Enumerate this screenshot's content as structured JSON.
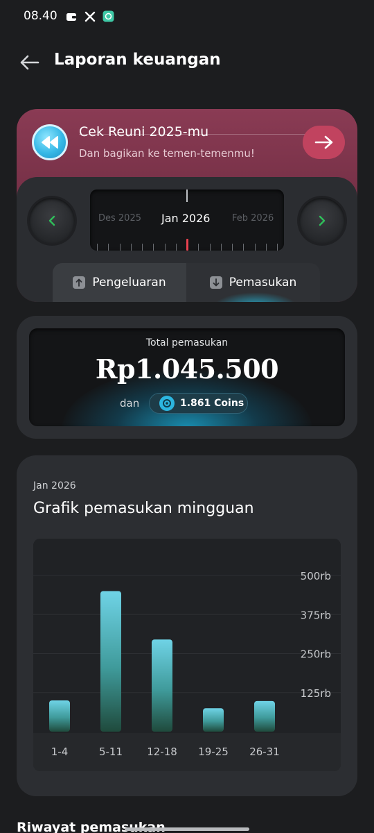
{
  "status_bar": {
    "time": "08.40",
    "icons": [
      "wallet-icon",
      "x-logo-icon",
      "chat-app-icon"
    ]
  },
  "app_bar": {
    "title": "Laporan keuangan"
  },
  "banner": {
    "title": "Cek Reuni 2025-mu",
    "subtitle": "Dan bagikan ke temen-temenmu!",
    "accent": "#c1435f"
  },
  "month_selector": {
    "previous": "Des 2025",
    "current": "Jan 2026",
    "next": "Feb 2026"
  },
  "tabs": [
    {
      "label": "Pengeluaran",
      "icon": "arrow-up-icon",
      "active": false
    },
    {
      "label": "Pemasukan",
      "icon": "arrow-down-icon",
      "active": true
    }
  ],
  "total": {
    "label": "Total pemasukan",
    "amount": "Rp1.045.500",
    "connector": "dan",
    "coins": "1.861 Coins"
  },
  "chart_section": {
    "month": "Jan 2026",
    "title": "Grafik pemasukan mingguan"
  },
  "chart_data": {
    "type": "bar",
    "categories": [
      "1-4",
      "5-11",
      "12-18",
      "19-25",
      "26-31"
    ],
    "values": [
      100000,
      450000,
      295000,
      75000,
      98000
    ],
    "y_ticks": [
      {
        "value": 500000,
        "label": "500rb"
      },
      {
        "value": 375000,
        "label": "375rb"
      },
      {
        "value": 250000,
        "label": "250rb"
      },
      {
        "value": 125000,
        "label": "125rb"
      }
    ],
    "ylim": [
      0,
      500000
    ],
    "grid": true,
    "bar_color_top": "#6fd3e6",
    "bar_color_bottom": "#1f4a3c"
  },
  "history": {
    "title": "Riwayat pemasukan"
  }
}
